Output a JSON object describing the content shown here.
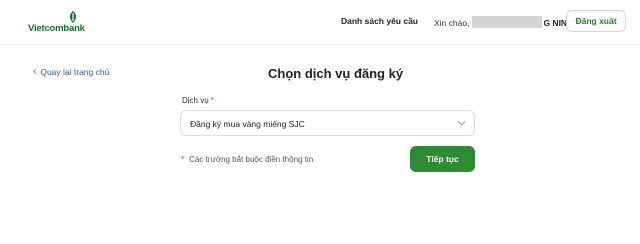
{
  "header": {
    "logo_text": "Vietcombank",
    "nav_requests": "Danh sách yêu cầu",
    "greeting_prefix": "Xin chào,",
    "greeting_name_tail": "G NINH",
    "logout_label": "Đăng xuất"
  },
  "main": {
    "back_label": "Quay lại trang chủ",
    "title": "Chọn dịch vụ đăng ký",
    "service_field": {
      "label": "Dịch vụ",
      "required_mark": "*",
      "value": "Đăng ký mua vàng miếng SJC"
    },
    "required_note": {
      "star": "*",
      "text": "Các trường bắt buộc điền thông tin"
    },
    "continue_label": "Tiếp tục"
  },
  "colors": {
    "brand_green": "#1e6b2b",
    "button_green": "#2f8a34",
    "link_blue": "#2c5fb5",
    "required_red": "#e0323c"
  }
}
